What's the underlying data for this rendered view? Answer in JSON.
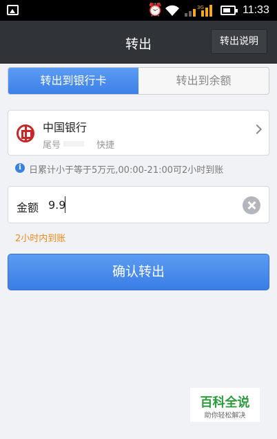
{
  "status_bar": {
    "time": "11:33",
    "alarm_icon": "alarm-clock-icon",
    "wifi_icon": "wifi-icon",
    "signal_icon": "signal-3g-icon",
    "battery_icon": "battery-icon"
  },
  "header": {
    "title": "转出",
    "help_label": "转出说明"
  },
  "tabs": [
    {
      "label": "转出到银行卡",
      "active": true
    },
    {
      "label": "转出到余额",
      "active": false
    }
  ],
  "bank": {
    "icon": "bank-of-china-logo-icon",
    "name": "中国银行",
    "tail_label": "尾号",
    "speed": "快捷"
  },
  "notice": "日累计小于等于5万元,00:00-21:00可2小时到账",
  "amount": {
    "label": "金额",
    "value": "9.9"
  },
  "eta": "2小时内到账",
  "confirm_label": "确认转出",
  "watermark": {
    "title": "百科全说",
    "subtitle": "助你轻松解决"
  },
  "colors": {
    "accent_blue": "#3d80e8",
    "eta_orange": "#f08a1c",
    "header_bg": "#303337"
  }
}
